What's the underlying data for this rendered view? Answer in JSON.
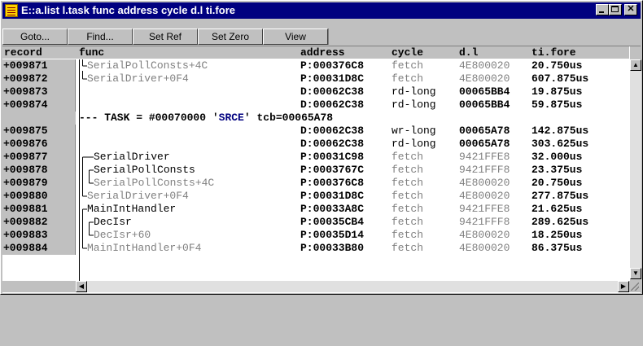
{
  "window": {
    "title": "E::a.list l.task func address cycle d.l ti.fore"
  },
  "toolbar": {
    "goto": "Goto...",
    "find": "Find...",
    "set_ref": "Set Ref",
    "set_zero": "Set Zero",
    "view": "View"
  },
  "columns": {
    "record": "record",
    "func": "func",
    "address": "address",
    "cycle": "cycle",
    "dl": "d.l",
    "tifore": "ti.fore"
  },
  "rows": [
    {
      "record": "+009871",
      "func": "SerialPollConsts+4C",
      "address": "P:000376C8",
      "cycle": "fetch",
      "dl": "4E800020",
      "tifore": "20.750us"
    },
    {
      "record": "+009872",
      "func": "SerialDriver+0F4",
      "address": "P:00031D8C",
      "cycle": "fetch",
      "dl": "4E800020",
      "tifore": "607.875us"
    },
    {
      "record": "+009873",
      "func": "",
      "address": "D:00062C38",
      "cycle": "rd-long",
      "dl": "00065BB4",
      "tifore": "19.875us"
    },
    {
      "record": "+009874",
      "func": "",
      "address": "D:00062C38",
      "cycle": "rd-long",
      "dl": "00065BB4",
      "tifore": "59.875us"
    },
    {
      "record": "",
      "task_prefix": "--- TASK = #00070000 '",
      "task_name": "SRCE",
      "task_suffix": "' tcb=00065A78"
    },
    {
      "record": "+009875",
      "func": "",
      "address": "D:00062C38",
      "cycle": "wr-long",
      "dl": "00065A78",
      "tifore": "142.875us"
    },
    {
      "record": "+009876",
      "func": "",
      "address": "D:00062C38",
      "cycle": "rd-long",
      "dl": "00065A78",
      "tifore": "303.625us"
    },
    {
      "record": "+009877",
      "func": "SerialDriver",
      "address": "P:00031C98",
      "cycle": "fetch",
      "dl": "9421FFE8",
      "tifore": "32.000us"
    },
    {
      "record": "+009878",
      "func": "SerialPollConsts",
      "address": "P:0003767C",
      "cycle": "fetch",
      "dl": "9421FFF8",
      "tifore": "23.375us"
    },
    {
      "record": "+009879",
      "func": "SerialPollConsts+4C",
      "address": "P:000376C8",
      "cycle": "fetch",
      "dl": "4E800020",
      "tifore": "20.750us"
    },
    {
      "record": "+009880",
      "func": "SerialDriver+0F4",
      "address": "P:00031D8C",
      "cycle": "fetch",
      "dl": "4E800020",
      "tifore": "277.875us"
    },
    {
      "record": "+009881",
      "func": "MainIntHandler",
      "address": "P:00033A8C",
      "cycle": "fetch",
      "dl": "9421FFE8",
      "tifore": "21.625us"
    },
    {
      "record": "+009882",
      "func": "DecIsr",
      "address": "P:00035CB4",
      "cycle": "fetch",
      "dl": "9421FFF8",
      "tifore": "289.625us"
    },
    {
      "record": "+009883",
      "func": "DecIsr+60",
      "address": "P:00035D14",
      "cycle": "fetch",
      "dl": "4E800020",
      "tifore": "18.250us"
    },
    {
      "record": "+009884",
      "func": "MainIntHandler+0F4",
      "address": "P:00033B80",
      "cycle": "fetch",
      "dl": "4E800020",
      "tifore": "86.375us"
    }
  ]
}
